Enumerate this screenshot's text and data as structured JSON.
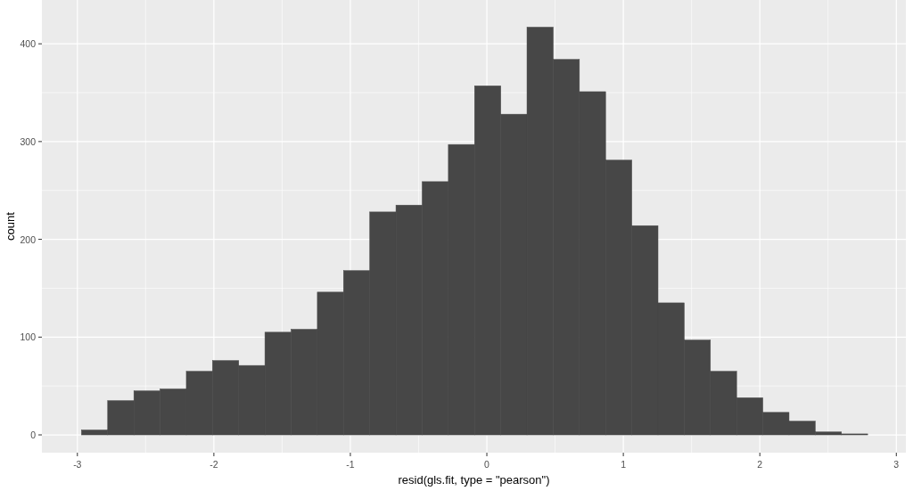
{
  "chart_data": {
    "type": "bar",
    "xlabel": "resid(gls.fit, type = \"pearson\")",
    "ylabel": "count",
    "x": [
      -2.874,
      -2.682,
      -2.49,
      -2.298,
      -2.106,
      -1.914,
      -1.722,
      -1.53,
      -1.338,
      -1.146,
      -0.954,
      -0.762,
      -0.57,
      -0.378,
      -0.186,
      0.006,
      0.198,
      0.39,
      0.582,
      0.774,
      0.966,
      1.158,
      1.35,
      1.542,
      1.734,
      1.926,
      2.118,
      2.31,
      2.502,
      2.694
    ],
    "grid": true,
    "series": [
      {
        "color": "#474747",
        "values": [
          5,
          35,
          45,
          47,
          65,
          76,
          71,
          105,
          108,
          146,
          168,
          228,
          235,
          259,
          297,
          357,
          328,
          417,
          384,
          351,
          281,
          214,
          135,
          97,
          65,
          38,
          23,
          14,
          3,
          1
        ]
      }
    ],
    "xlim": [
      -3.26,
      3.07
    ],
    "ylim": [
      -18.2,
      444.8
    ],
    "xticks": [
      -3,
      -2,
      -1,
      0,
      1,
      2,
      3
    ],
    "yticks": [
      0,
      100,
      200,
      300,
      400
    ]
  }
}
